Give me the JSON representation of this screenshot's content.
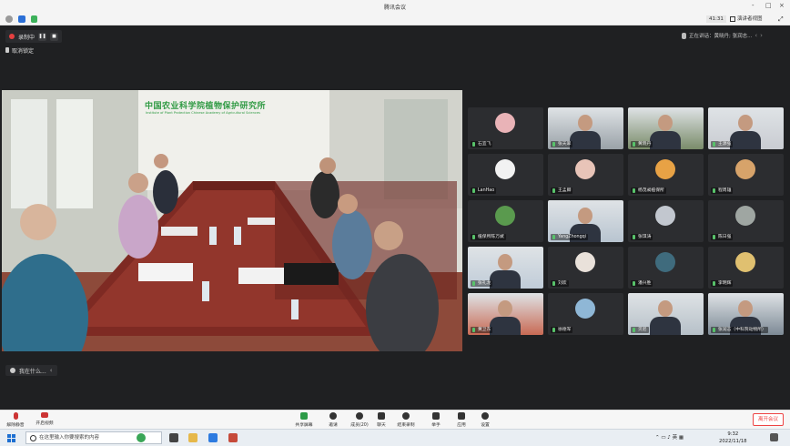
{
  "window": {
    "title": "腾讯会议",
    "controls": [
      "-",
      "□",
      "×"
    ]
  },
  "infobar": {
    "timer": "41:31",
    "view_label": "演讲者视图"
  },
  "recording": {
    "label": "录制中",
    "pause": "❚❚",
    "stop": "■"
  },
  "lock_label": "取消锁定",
  "main_video": {
    "sign_cn": "中国农业科学院植物保护研究所",
    "sign_en": "Institute of Plant Protection Chinese Academy of Agricultural Sciences"
  },
  "speaker_bar": {
    "label": "我在什么..."
  },
  "talking": {
    "label": "正在讲话：黄晓丹; 张润志...",
    "prev": "‹",
    "next": "›"
  },
  "participants": [
    {
      "name": "石宜飞",
      "avatar": "#e9b3b7",
      "video": false
    },
    {
      "name": "张天翠",
      "avatar": "#9aa2a8",
      "video": true
    },
    {
      "name": "黄晓丹",
      "avatar": "#7a8c6a",
      "video": true
    },
    {
      "name": "王源强",
      "avatar": "#c9ccd2",
      "video": true
    },
    {
      "name": "LanHao",
      "avatar": "#f2f2f2",
      "video": false
    },
    {
      "name": "王孟卿",
      "avatar": "#e8c4b8",
      "video": false
    },
    {
      "name": "杨茂昶植保所",
      "avatar": "#e8a245",
      "video": false
    },
    {
      "name": "程周雄",
      "avatar": "#d7a36a",
      "video": false
    },
    {
      "name": "植保所陈万斌",
      "avatar": "#5a9a4e",
      "video": false
    },
    {
      "name": "YangZhongqi",
      "avatar": "#b8c4d0",
      "video": true
    },
    {
      "name": "张琪涛",
      "avatar": "#c2c7cf",
      "video": false
    },
    {
      "name": "陈日强",
      "avatar": "#9fa6a2",
      "video": false
    },
    {
      "name": "张礼龙",
      "avatar": "#c0ccd8",
      "video": true
    },
    {
      "name": "刘欢",
      "avatar": "#e9e1da",
      "video": false
    },
    {
      "name": "潘兴胜",
      "avatar": "#3f6b7d",
      "video": false
    },
    {
      "name": "李明辉",
      "avatar": "#e0c070",
      "video": false
    },
    {
      "name": "黄卫东",
      "avatar": "#c86a54",
      "video": true
    },
    {
      "name": "徐德军",
      "avatar": "#8fb7d6",
      "video": false
    },
    {
      "name": "贝尼",
      "avatar": "#b6c0c8",
      "video": true
    },
    {
      "name": "张润志（中科院动物所）",
      "avatar": "#7d8a96",
      "video": true
    }
  ],
  "toolbar": {
    "mute": "解除静音",
    "video": "开启视频",
    "share": "共享屏幕",
    "invite": "邀请",
    "members": "成员(20)",
    "chat": "聊天",
    "record": "结束录制",
    "raise": "举手",
    "apps": "应用",
    "settings": "设置",
    "leave": "离开会议"
  },
  "taskbar": {
    "search_placeholder": "在这里输入你要搜索的内容",
    "ime": "英",
    "time": "9:32",
    "date": "2022/11/18"
  },
  "colors": {
    "accent": "#2f9a43",
    "danger": "#e64040",
    "stage_bg": "#1f2022"
  }
}
